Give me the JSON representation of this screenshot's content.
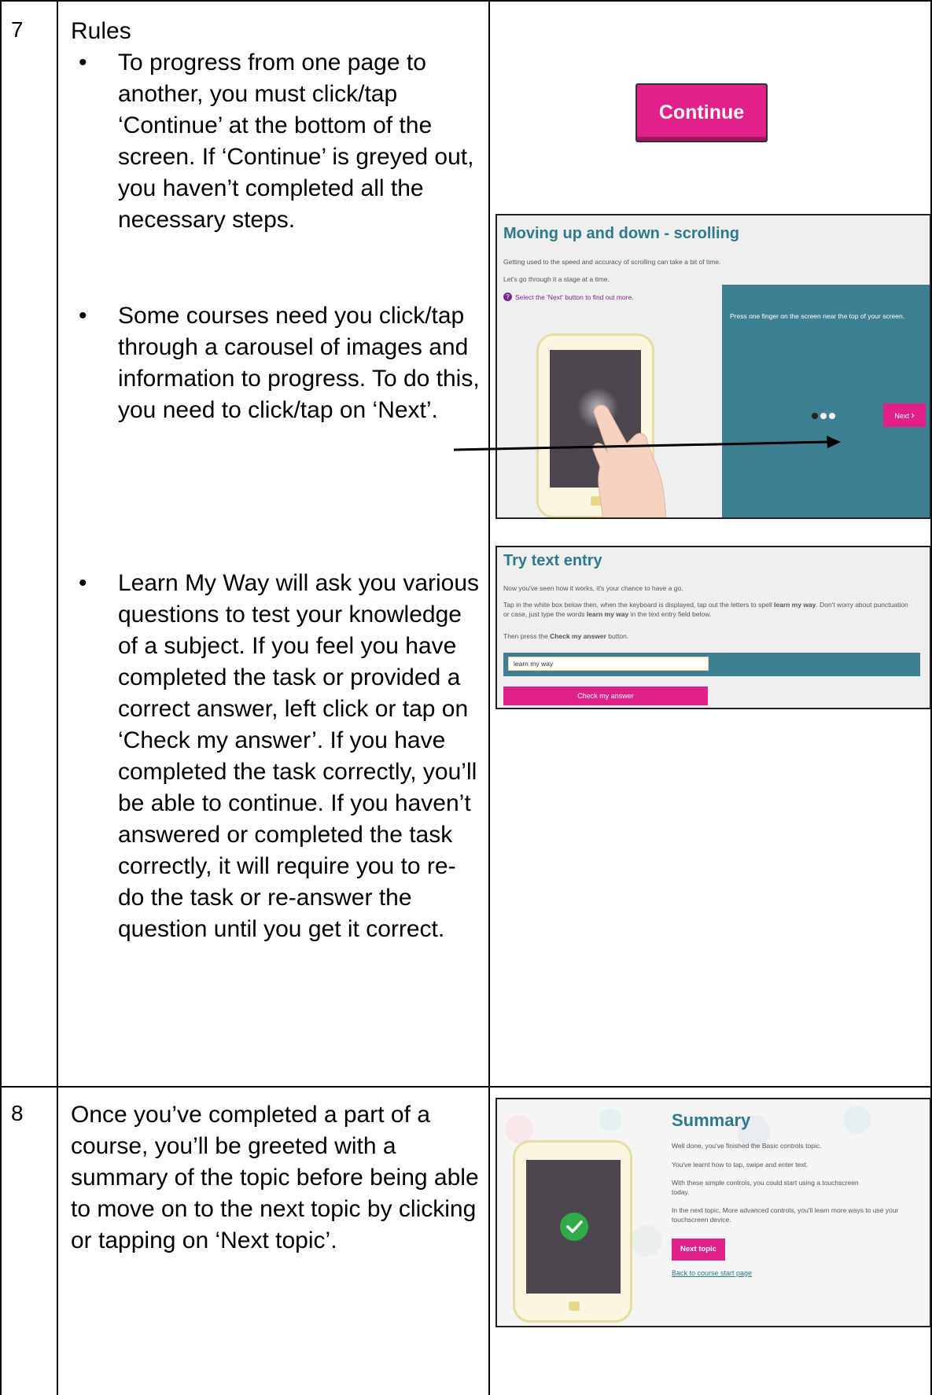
{
  "rows": [
    {
      "number": "7",
      "heading": "Rules",
      "bullets": [
        "To progress from one page to another, you must click/tap ‘Continue’ at the bottom of the screen. If ‘Continue’ is greyed out, you haven’t completed all the necessary steps.",
        "Some courses need you click/tap through a carousel of images and information to progress. To do this, you need to click/tap on ‘Next’.",
        "Learn My Way will ask you various questions to test your knowledge of a subject. If you feel you have completed the task or provided a correct answer, left click or tap on ‘Check my answer’. If you have completed the task correctly, you’ll be able to continue. If you haven’t answered or completed the task correctly, it will require you to re-do the task or re-answer the question until you get it correct."
      ]
    },
    {
      "number": "8",
      "text": "Once you’ve completed a part of a course, you’ll be greeted with a summary of the topic before being able to move on to the next topic by clicking or tapping on ‘Next topic’."
    }
  ],
  "continue_button": {
    "label": "Continue",
    "color": "#e0218a"
  },
  "scrolling_screen": {
    "title": "Moving up and down - scrolling",
    "line1": "Getting used to the speed and accuracy of scrolling can take a bit of time.",
    "line2": "Let's go through it a stage at a time.",
    "hint": "Select the 'Next' button to find out more.",
    "panel_text": "Press one finger on the screen near the top of your screen.",
    "next_label": "Next",
    "panel_color": "#3e7f93"
  },
  "text_entry_screen": {
    "title": "Try text entry",
    "line1": "Now you've seen how it works, it's your chance to have a go.",
    "line2_a": "Tap in the white box below then, when the keyboard is displayed, tap out the letters to spell ",
    "line2_bold1": "learn my way",
    "line2_b": ". Don't worry about punctuation or case, just type the words ",
    "line2_bold2": "learn my way",
    "line2_c": " in the text entry field below.",
    "line3_a": "Then press the ",
    "line3_bold": "Check my answer",
    "line3_b": " button.",
    "input_value": "learn my way",
    "button_label": "Check my answer"
  },
  "summary_screen": {
    "title": "Summary",
    "p1": "Well done, you've finished the Basic controls topic.",
    "p2": "You've learnt how to tap, swipe and enter text.",
    "p3": "With these simple controls, you could start using a touchscreen today.",
    "p4": "In the next topic, More advanced controls, you'll learn more ways to use your touchscreen device.",
    "next_topic_label": "Next topic",
    "back_link": "Back to course start page"
  }
}
